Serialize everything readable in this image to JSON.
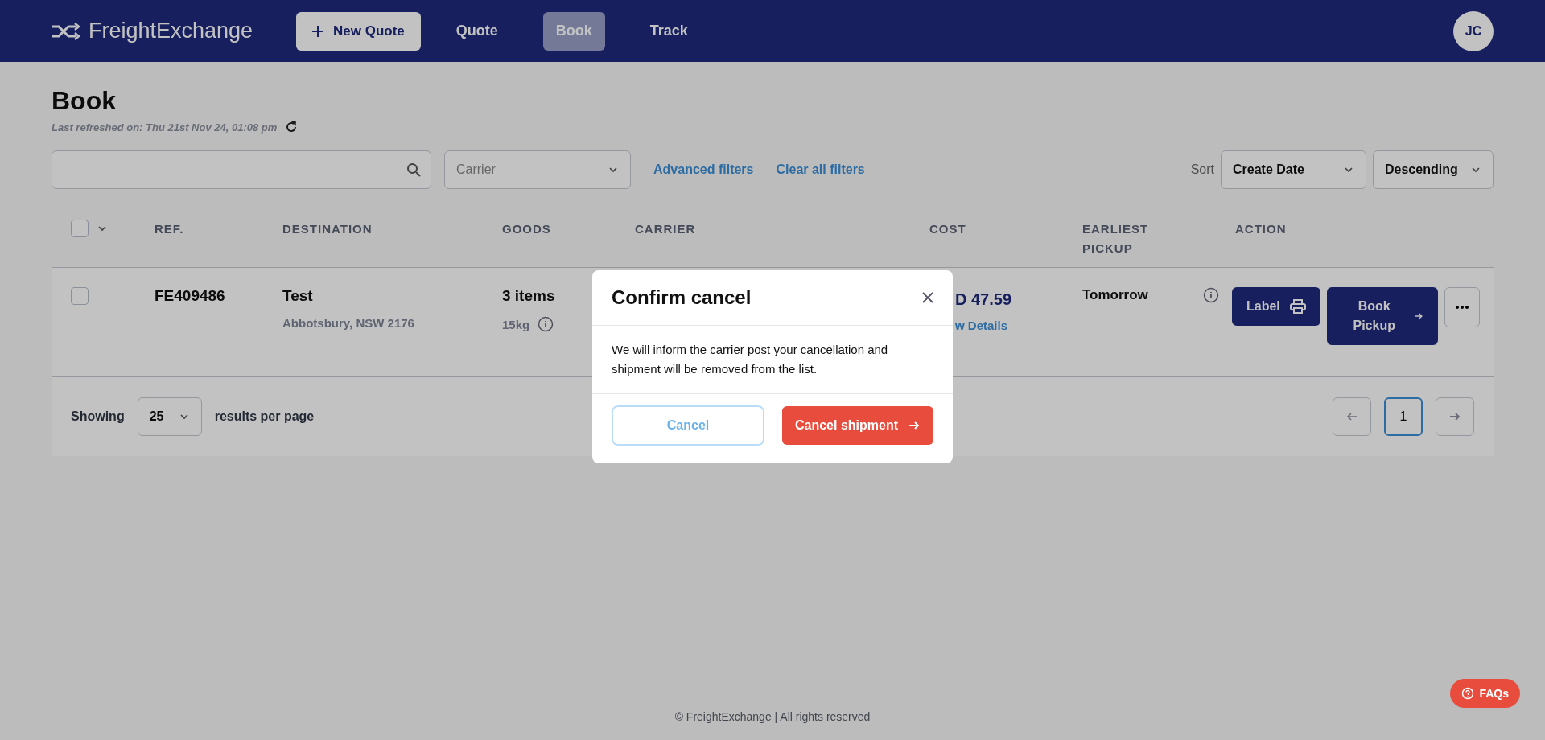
{
  "header": {
    "logo": "FreightExchange",
    "new_quote_button": "New Quote",
    "nav": [
      {
        "label": "Quote",
        "selected": false
      },
      {
        "label": "Book",
        "selected": true
      },
      {
        "label": "Track",
        "selected": false
      }
    ],
    "avatar": "JC"
  },
  "page": {
    "title": "Book",
    "refreshed": "Last refreshed on: Thu 21st Nov 24, 01:08 pm"
  },
  "filters": {
    "carrier_placeholder": "Carrier",
    "links": [
      "Advanced filters",
      "Clear all filters"
    ],
    "sort_label": "Sort",
    "sort_fields": [
      "Create Date",
      "Descending"
    ]
  },
  "table": {
    "select_all_checked": false,
    "columns": [
      "REF.",
      "DESTINATION",
      "GOODS",
      "CARRIER",
      "COST",
      "EARLIEST PICKUP",
      "ACTION"
    ],
    "rows": [
      {
        "checked": false,
        "ref": "FE409486",
        "destination": "Test",
        "address": "Abbotsbury, NSW 2176",
        "goods": "3 items",
        "weight": "15kg",
        "cost": "D 47.59",
        "cost_link": "w Details",
        "pickup": "Tomorrow",
        "label_button": "Label",
        "book_button": "Book Pickup"
      }
    ]
  },
  "pagination": {
    "showing": "Showing",
    "per_page": "25",
    "suffix": "results per page",
    "pages": [
      {
        "label": "1",
        "selected": true
      }
    ]
  },
  "modal": {
    "title": "Confirm cancel",
    "body": "We will inform the carrier post your cancellation and shipment will be removed from the list.",
    "cancel_button": "Cancel",
    "confirm_button": "Cancel shipment"
  },
  "footer": {
    "text": "© FreightExchange | All rights reserved",
    "faq_button": "FAQs"
  }
}
